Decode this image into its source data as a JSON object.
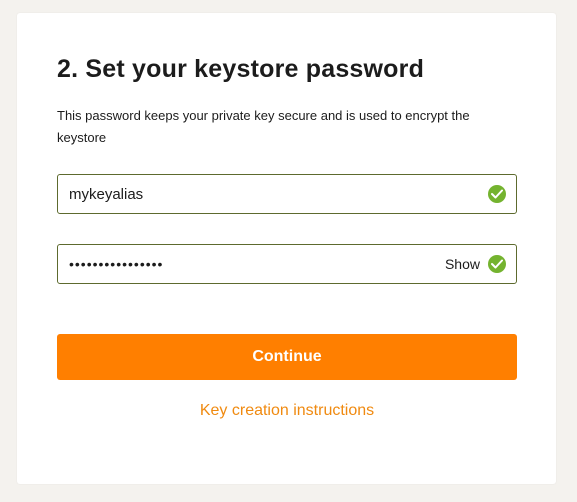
{
  "card": {
    "title": "2. Set your keystore password",
    "description": "This password keeps your private key secure and is used to encrypt the keystore"
  },
  "alias_field": {
    "value": "mykeyalias",
    "status_icon": "check-circle-icon"
  },
  "password_field": {
    "value": "mykeystorepasswd",
    "show_label": "Show",
    "status_icon": "check-circle-icon"
  },
  "actions": {
    "continue_label": "Continue",
    "instructions_link": "Key creation instructions"
  },
  "colors": {
    "accent": "#ff7f00",
    "link": "#f08a10",
    "valid": "#74b32f",
    "field_border": "#5d6a2e"
  }
}
